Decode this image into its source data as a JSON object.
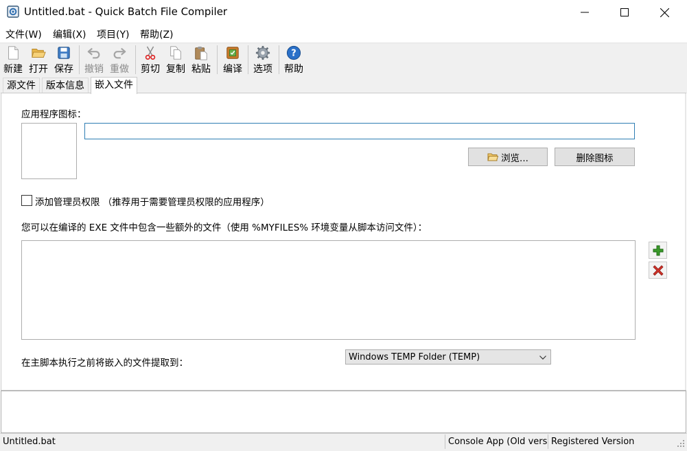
{
  "window": {
    "title": "Untitled.bat - Quick Batch File Compiler"
  },
  "menu": [
    "文件(W)",
    "编辑(X)",
    "项目(Y)",
    "帮助(Z)"
  ],
  "toolbar": {
    "new": "新建",
    "open": "打开",
    "save": "保存",
    "undo": "撤销",
    "redo": "重做",
    "cut": "剪切",
    "copy": "复制",
    "paste": "粘贴",
    "compile": "编译",
    "options": "选项",
    "help": "帮助"
  },
  "tabs": [
    "源文件",
    "版本信息",
    "嵌入文件"
  ],
  "embed": {
    "icon_label": "应用程序图标：",
    "icon_path_value": "",
    "browse": "浏览...",
    "delete_icon": "删除图标",
    "admin_label": "添加管理员权限 （推荐用于需要管理员权限的应用程序）",
    "admin_checked": false,
    "files_label": "您可以在编译的 EXE 文件中包含一些额外的文件（使用 %MYFILES% 环境变量从脚本访问文件）：",
    "extract_label": "在主脚本执行之前将嵌入的文件提取到：",
    "extract_value": "Windows TEMP Folder (TEMP)"
  },
  "status": {
    "file": "Untitled.bat",
    "mode": "Console App (Old version",
    "license": "Registered Version"
  },
  "icons": {
    "app": "app-icon",
    "new": "new-file-icon",
    "open": "folder-open-icon",
    "save": "floppy-disk-icon",
    "undo": "undo-icon",
    "redo": "redo-icon",
    "cut": "scissors-icon",
    "copy": "copy-icon",
    "paste": "clipboard-icon",
    "compile": "compile-box-icon",
    "options": "gear-icon",
    "help": "help-icon",
    "add": "plus-icon",
    "remove": "delete-x-icon"
  },
  "colors": {
    "help_blue": "#2a70c8",
    "add_green": "#3a9a2a",
    "remove_red": "#d0332a",
    "focus_border": "#2d7db3"
  }
}
